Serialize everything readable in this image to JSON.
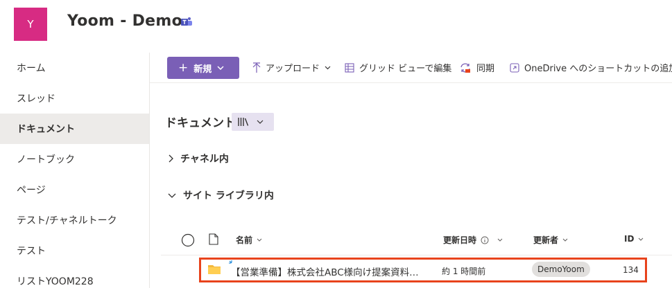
{
  "header": {
    "logo_letter": "Y",
    "site_title": "Yoom - Demo",
    "logo_color": "#d72b83"
  },
  "nav": {
    "items": [
      {
        "label": "ホーム",
        "active": false
      },
      {
        "label": "スレッド",
        "active": false
      },
      {
        "label": "ドキュメント",
        "active": true
      },
      {
        "label": "ノートブック",
        "active": false
      },
      {
        "label": "ページ",
        "active": false
      },
      {
        "label": "テスト/チャネルトーク",
        "active": false
      },
      {
        "label": "テスト",
        "active": false
      },
      {
        "label": "リストYOOM228",
        "active": false
      }
    ]
  },
  "toolbar": {
    "new_label": "新規",
    "upload_label": "アップロード",
    "grid_edit_label": "グリッド ビューで編集",
    "sync_label": "同期",
    "shortcut_label": "OneDrive へのショートカットの追加",
    "accent_color": "#7a5fb6"
  },
  "main": {
    "title": "ドキュメント",
    "sections": [
      {
        "label": "チャネル内",
        "expanded": false
      },
      {
        "label": "サイト ライブラリ内",
        "expanded": true
      }
    ],
    "columns": {
      "name": "名前",
      "modified": "更新日時",
      "modified_by": "更新者",
      "id": "ID"
    },
    "rows": [
      {
        "name": "【営業準備】株式会社ABC様向け提案資料…",
        "modified": "約 1 時間前",
        "modified_by": "DemoYoom",
        "id": "134",
        "type": "folder"
      }
    ],
    "highlight_color": "#e8431c"
  }
}
